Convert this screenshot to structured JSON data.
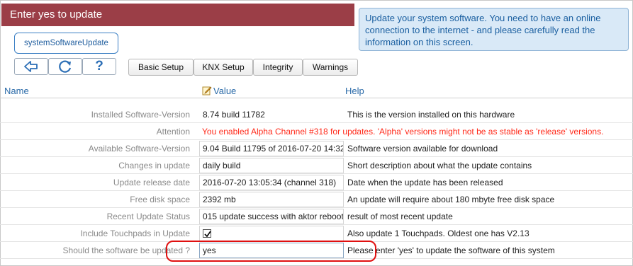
{
  "title": "Enter yes to update",
  "info_text": "Update your system software. You need to have an online connection to the internet - and please carefully read the information on this screen.",
  "module_label": "systemSoftwareUpdate",
  "toolbar": {
    "back_icon": "back-arrow-icon",
    "refresh_icon": "refresh-icon",
    "help_label": "?"
  },
  "tabs": [
    {
      "label": "Basic Setup"
    },
    {
      "label": "KNX Setup"
    },
    {
      "label": "Integrity"
    },
    {
      "label": "Warnings"
    }
  ],
  "columns": {
    "name": "Name",
    "value": "Value",
    "help": "Help"
  },
  "rows": [
    {
      "label": "Installed Software-Version",
      "value": "8.74 build 11782",
      "help": "This is the version installed on this hardware"
    },
    {
      "label": "Attention",
      "message": "You enabled Alpha Channel #318 for updates. 'Alpha' versions might not be as stable as 'release' versions."
    },
    {
      "label": "Available Software-Version",
      "value": "9.04 Build 11795 of 2016-07-20 14:32",
      "help": "Software version available for download"
    },
    {
      "label": "Changes in update",
      "value": "daily build",
      "help": "Short description about what the update contains"
    },
    {
      "label": "Update release date",
      "value": "2016-07-20 13:05:34 (channel 318)",
      "help": "Date when the update has been released"
    },
    {
      "label": "Free disk space",
      "value": "2392 mb",
      "help": "An update will require about 180 mbyte free disk space"
    },
    {
      "label": "Recent Update Status",
      "value": "015 update success with aktor reboot",
      "help": "result of most recent update"
    },
    {
      "label": "Include Touchpads in Update",
      "checked": true,
      "help": "Also update 1 Touchpads. Oldest one has V2.13"
    },
    {
      "label": "Should the software be updated ?",
      "value": "yes",
      "help": "Please enter 'yes' to update the software of this system"
    }
  ],
  "colors": {
    "title_bg": "#9b3e47",
    "alert": "#ff2a1a",
    "link": "#2a6aa8",
    "highlight": "#e01010"
  }
}
